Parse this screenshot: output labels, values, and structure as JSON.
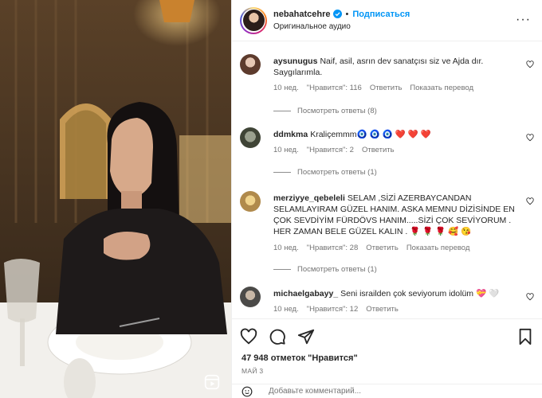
{
  "header": {
    "username": "nebahatcehre",
    "separator": "•",
    "follow_label": "Подписаться",
    "audio": "Оригинальное аудио",
    "more_label": "···"
  },
  "comments": [
    {
      "user": "aysunugus",
      "text": "Naif, asil, asrın dev sanatçısı siz ve Ajda dır. Saygılarımla.",
      "time": "10 нед.",
      "likes": "\"Нравится\": 116",
      "reply": "Ответить",
      "translate": "Показать перевод",
      "view_replies": "Посмотреть ответы (8)"
    },
    {
      "user": "ddmkma",
      "text": "Kraliçemmm🧿 🧿 🧿 ❤️ ❤️ ❤️",
      "time": "10 нед.",
      "likes": "\"Нравится\": 2",
      "reply": "Ответить",
      "view_replies": "Посмотреть ответы (1)"
    },
    {
      "user": "merziyye_qebeleli",
      "text": "SELAM ,SİZİ AZERBAYCANDAN SELAMLAYIRAM GÜZEL HANIM. ASKA MEMNU DİZİSİNDE EN ÇOK SEVDİYİM FÜRDÖVS HANIM.....SİZİ ÇOK SEVİYORUM . HER ZAMAN BELE GÜZEL KALIN . 🌹 🌹 🌹 🥰 😘",
      "time": "10 нед.",
      "likes": "\"Нравится\": 28",
      "reply": "Ответить",
      "translate": "Показать перевод",
      "view_replies": "Посмотреть ответы (1)"
    },
    {
      "user": "michaelgabayy_",
      "text": "Seni israilden çok seviyorum idolüm 💝 🤍",
      "time": "10 нед.",
      "likes": "\"Нравится\": 12",
      "reply": "Ответить"
    }
  ],
  "likes_count": "47 948 отметок \"Нравится\"",
  "post_date": "МАЙ 3",
  "comment_placeholder": "Добавьте комментарий...",
  "icons": {
    "like": "heart-icon",
    "comment": "comment-icon",
    "share": "send-icon",
    "save": "bookmark-icon",
    "emoji": "smiley-icon",
    "reel": "reels-icon"
  },
  "colors": {
    "follow": "#0095f6",
    "muted": "#737373",
    "text": "#262626"
  }
}
